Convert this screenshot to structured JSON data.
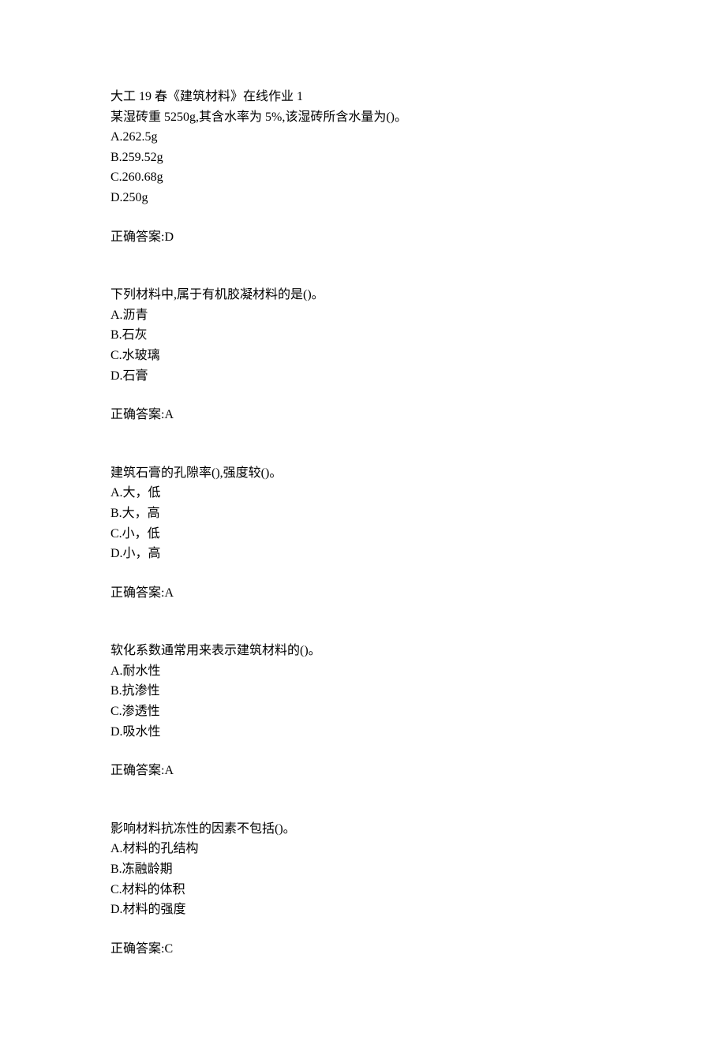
{
  "header": {
    "title": "大工 19 春《建筑材料》在线作业 1"
  },
  "questions": [
    {
      "stem": "某湿砖重 5250g,其含水率为 5%,该湿砖所含水量为()。",
      "options": [
        "A.262.5g",
        "B.259.52g",
        "C.260.68g",
        "D.250g"
      ],
      "answer": "正确答案:D"
    },
    {
      "stem": "下列材料中,属于有机胶凝材料的是()。",
      "options": [
        "A.沥青",
        "B.石灰",
        "C.水玻璃",
        "D.石膏"
      ],
      "answer": "正确答案:A"
    },
    {
      "stem": "建筑石膏的孔隙率(),强度较()。",
      "options": [
        "A.大，低",
        "B.大，高",
        "C.小，低",
        "D.小，高"
      ],
      "answer": "正确答案:A"
    },
    {
      "stem": "软化系数通常用来表示建筑材料的()。",
      "options": [
        "A.耐水性",
        "B.抗渗性",
        "C.渗透性",
        "D.吸水性"
      ],
      "answer": "正确答案:A"
    },
    {
      "stem": "影响材料抗冻性的因素不包括()。",
      "options": [
        "A.材料的孔结构",
        "B.冻融龄期",
        "C.材料的体积",
        "D.材料的强度"
      ],
      "answer": "正确答案:C"
    }
  ]
}
